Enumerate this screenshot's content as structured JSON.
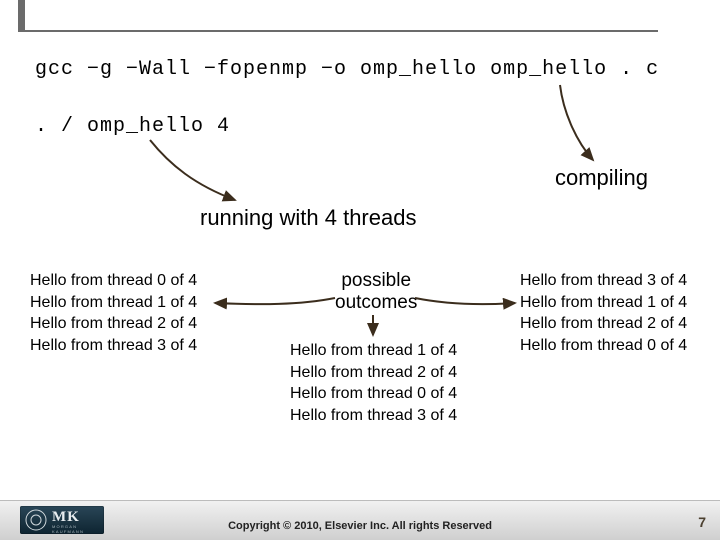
{
  "code": {
    "compile": "gcc −g −Wall −fopenmp −o omp_hello omp_hello . c",
    "run": ". / omp_hello 4"
  },
  "labels": {
    "compiling": "compiling",
    "running": "running with 4 threads",
    "possible_line1": "possible",
    "possible_line2": "outcomes"
  },
  "outputs": {
    "left": [
      "Hello from thread 0 of 4",
      "Hello from thread 1 of 4",
      "Hello from thread 2 of 4",
      "Hello from thread 3 of 4"
    ],
    "mid": [
      "Hello from thread 1 of 4",
      "Hello from thread 2 of 4",
      "Hello from thread 0 of 4",
      "Hello from thread 3 of 4"
    ],
    "right": [
      "Hello from thread 3 of 4",
      "Hello from thread 1 of 4",
      "Hello from thread 2 of 4",
      "Hello from thread 0 of 4"
    ]
  },
  "footer": {
    "copyright": "Copyright © 2010, Elsevier Inc. All rights Reserved",
    "page": "7",
    "badge": "MK",
    "badge_sub": "MORGAN KAUFMANN"
  },
  "colors": {
    "arrow": "#3b2d1d"
  }
}
